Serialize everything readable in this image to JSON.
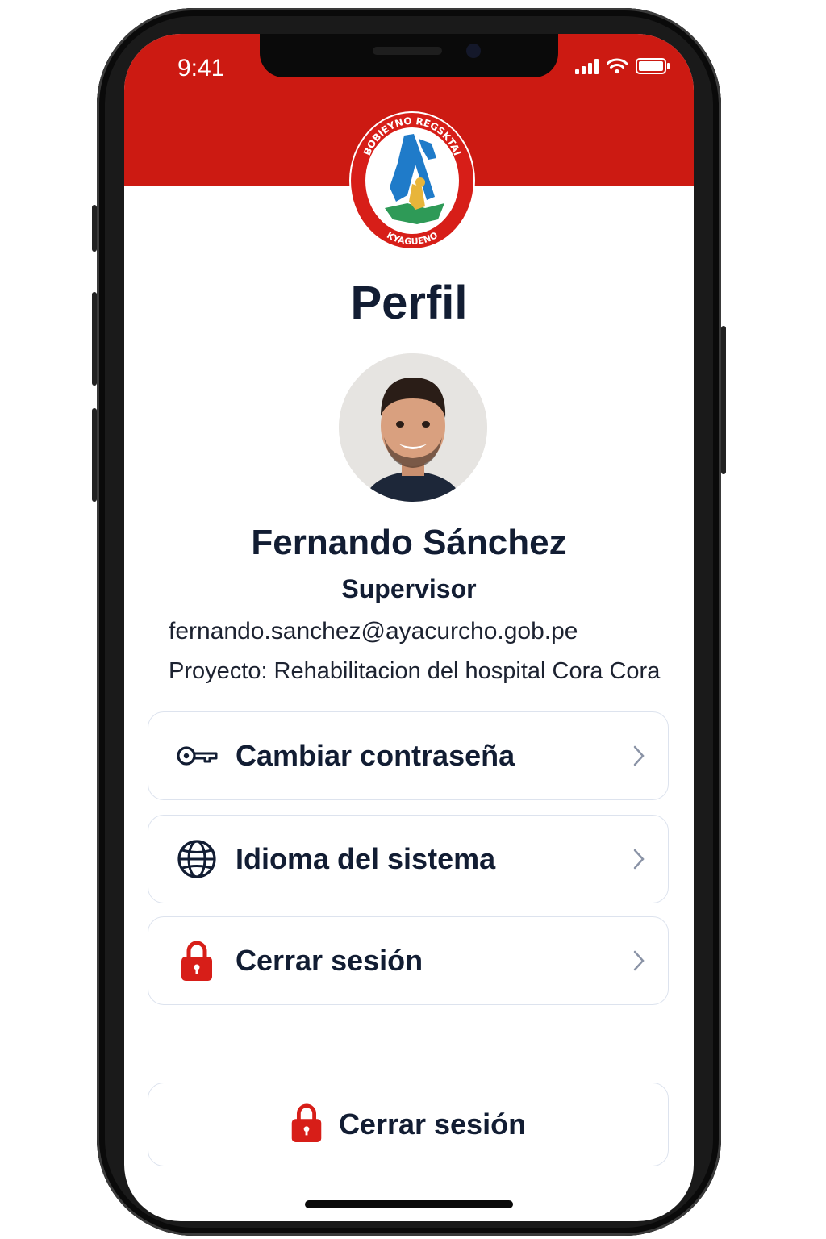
{
  "status_bar": {
    "time": "9:41"
  },
  "logo": {
    "top_text": "BOBIEYNO REGSKTAI",
    "bottom_text": "KYAGUENO"
  },
  "page": {
    "title": "Perfil"
  },
  "profile": {
    "name": "Fernando Sánchez",
    "role": "Supervisor",
    "email": "fernando.sanchez@ayacurcho.gob.pe",
    "project": "Proyecto: Rehabilitacion del hospital Cora Cora"
  },
  "menu": [
    {
      "label": "Cambiar contraseña",
      "icon": "key-icon"
    },
    {
      "label": "Idioma del sistema",
      "icon": "globe-icon"
    },
    {
      "label": "Cerrar sesión",
      "icon": "lock-icon"
    }
  ],
  "logout_button": {
    "label": "Cerrar sesión",
    "icon": "lock-icon"
  },
  "colors": {
    "brand_red": "#cc1a12",
    "text_dark": "#121d33",
    "border": "#dde3ee"
  }
}
